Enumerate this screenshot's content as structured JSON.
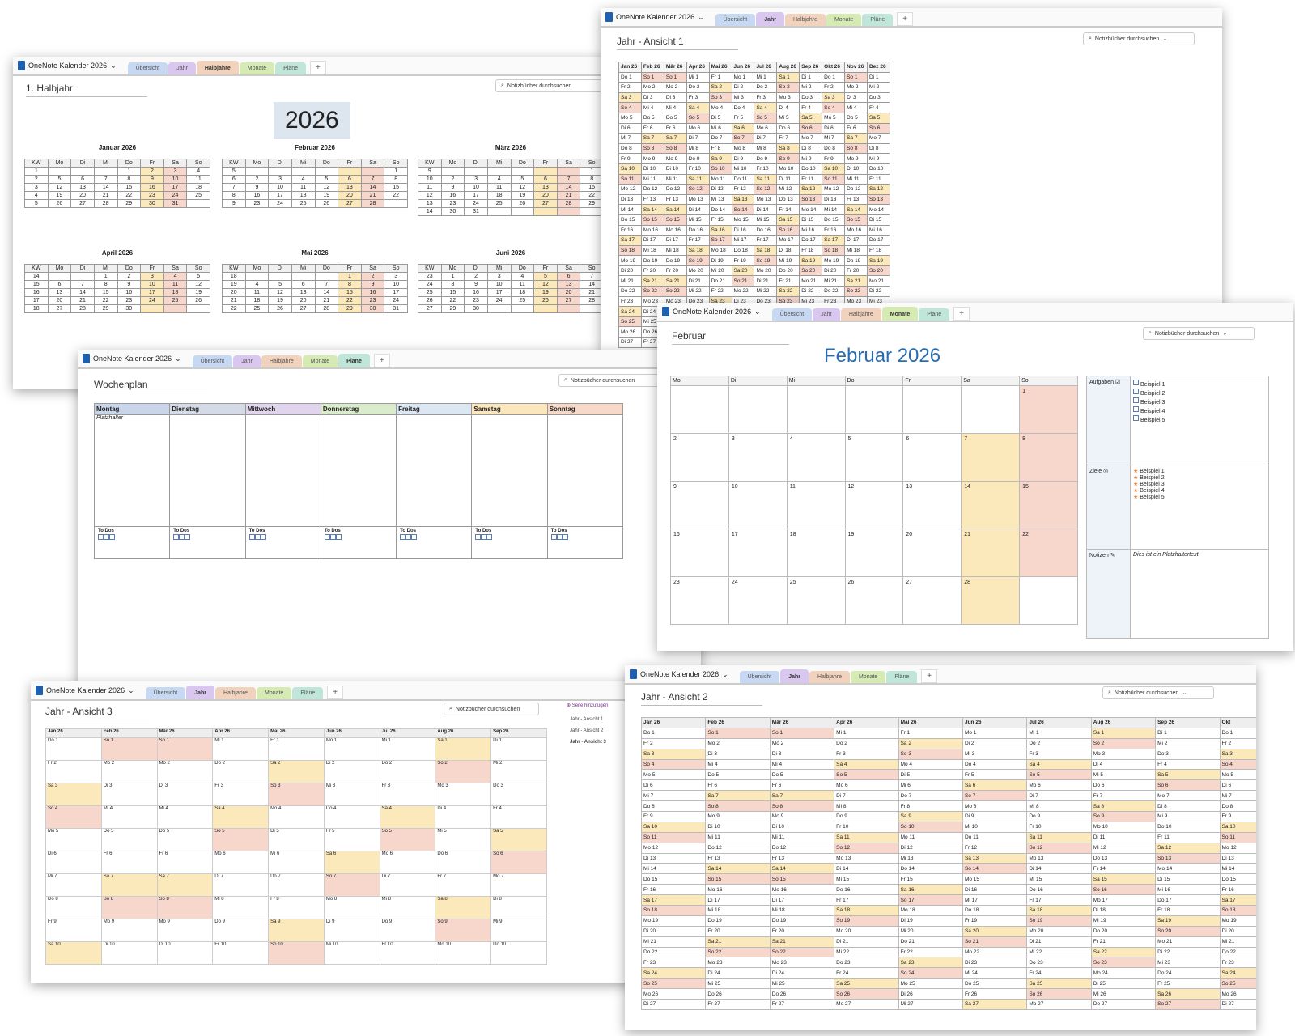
{
  "app": {
    "notebook": "OneNote Kalender 2026",
    "search_placeholder": "Notizbücher durchsuchen",
    "tabs": [
      "Übersicht",
      "Jahr",
      "Halbjahre",
      "Monate",
      "Pläne"
    ],
    "add_tab": "+"
  },
  "colors": {
    "tab_uebersicht": "#c7d9f2",
    "tab_jahr": "#d9c7f0",
    "tab_halbjahre": "#f1d3bd",
    "tab_monate": "#d6ebb4",
    "tab_plaene": "#bfe6d8",
    "saturday": "#fbe9bb",
    "sunday": "#f7d6cc",
    "month_title": "#2a6cb0"
  },
  "halbjahr": {
    "title": "1. Halbjahr",
    "year": "2026",
    "weekday_headers": [
      "KW",
      "Mo",
      "Di",
      "Mi",
      "Do",
      "Fr",
      "Sa",
      "So"
    ],
    "months": [
      {
        "name": "Januar 2026",
        "rows": [
          [
            "1",
            "",
            "",
            "",
            "1",
            "2",
            "3",
            "4"
          ],
          [
            "2",
            "5",
            "6",
            "7",
            "8",
            "9",
            "10",
            "11"
          ],
          [
            "3",
            "12",
            "13",
            "14",
            "15",
            "16",
            "17",
            "18"
          ],
          [
            "4",
            "19",
            "20",
            "21",
            "22",
            "23",
            "24",
            "25"
          ],
          [
            "5",
            "26",
            "27",
            "28",
            "29",
            "30",
            "31",
            ""
          ]
        ]
      },
      {
        "name": "Februar 2026",
        "rows": [
          [
            "5",
            "",
            "",
            "",
            "",
            "",
            "",
            "1"
          ],
          [
            "6",
            "2",
            "3",
            "4",
            "5",
            "6",
            "7",
            "8"
          ],
          [
            "7",
            "9",
            "10",
            "11",
            "12",
            "13",
            "14",
            "15"
          ],
          [
            "8",
            "16",
            "17",
            "18",
            "19",
            "20",
            "21",
            "22"
          ],
          [
            "9",
            "23",
            "24",
            "25",
            "26",
            "27",
            "28",
            ""
          ]
        ]
      },
      {
        "name": "März 2026",
        "rows": [
          [
            "9",
            "",
            "",
            "",
            "",
            "",
            "",
            "1"
          ],
          [
            "10",
            "2",
            "3",
            "4",
            "5",
            "6",
            "7",
            "8"
          ],
          [
            "11",
            "9",
            "10",
            "11",
            "12",
            "13",
            "14",
            "15"
          ],
          [
            "12",
            "16",
            "17",
            "18",
            "19",
            "20",
            "21",
            "22"
          ],
          [
            "13",
            "23",
            "24",
            "25",
            "26",
            "27",
            "28",
            "29"
          ],
          [
            "14",
            "30",
            "31",
            "",
            "",
            "",
            "",
            ""
          ]
        ]
      },
      {
        "name": "April 2026",
        "rows": [
          [
            "14",
            "",
            "",
            "1",
            "2",
            "3",
            "4",
            "5"
          ],
          [
            "15",
            "6",
            "7",
            "8",
            "9",
            "10",
            "11",
            "12"
          ],
          [
            "16",
            "13",
            "14",
            "15",
            "16",
            "17",
            "18",
            "19"
          ],
          [
            "17",
            "20",
            "21",
            "22",
            "23",
            "24",
            "25",
            "26"
          ],
          [
            "18",
            "27",
            "28",
            "29",
            "30",
            "",
            "",
            ""
          ]
        ]
      },
      {
        "name": "Mai 2026",
        "rows": [
          [
            "18",
            "",
            "",
            "",
            "",
            "1",
            "2",
            "3"
          ],
          [
            "19",
            "4",
            "5",
            "6",
            "7",
            "8",
            "9",
            "10"
          ],
          [
            "20",
            "11",
            "12",
            "13",
            "14",
            "15",
            "16",
            "17"
          ],
          [
            "21",
            "18",
            "19",
            "20",
            "21",
            "22",
            "23",
            "24"
          ],
          [
            "22",
            "25",
            "26",
            "27",
            "28",
            "29",
            "30",
            "31"
          ]
        ]
      },
      {
        "name": "Juni 2026",
        "rows": [
          [
            "23",
            "1",
            "2",
            "3",
            "4",
            "5",
            "6",
            "7"
          ],
          [
            "24",
            "8",
            "9",
            "10",
            "11",
            "12",
            "13",
            "14"
          ],
          [
            "25",
            "15",
            "16",
            "17",
            "18",
            "19",
            "20",
            "21"
          ],
          [
            "26",
            "22",
            "23",
            "24",
            "25",
            "26",
            "27",
            "28"
          ],
          [
            "27",
            "29",
            "30",
            "",
            "",
            "",
            "",
            ""
          ]
        ]
      }
    ]
  },
  "jahr1": {
    "title": "Jahr - Ansicht 1",
    "months": [
      "Jan 26",
      "Feb 26",
      "Mär 26",
      "Apr 26",
      "Mai 26",
      "Jun 26",
      "Jul 26",
      "Aug 26",
      "Sep 26",
      "Okt 26",
      "Nov 26",
      "Dez 26"
    ]
  },
  "wochenplan": {
    "title": "Wochenplan",
    "days": [
      "Montag",
      "Dienstag",
      "Mittwoch",
      "Donnerstag",
      "Freitag",
      "Samstag",
      "Sonntag"
    ],
    "day_colors": [
      "#c9d6ea",
      "#d4dae6",
      "#e0d5ec",
      "#dbeccc",
      "#dde7f4",
      "#fbe7bd",
      "#f7d9c9"
    ],
    "placeholder": "Platzhalter",
    "todos": "To Dos"
  },
  "monat": {
    "title": "Februar",
    "heading": "Februar 2026",
    "weekdays": [
      "Mo",
      "Di",
      "Mi",
      "Do",
      "Fr",
      "Sa",
      "So"
    ],
    "weeks": [
      [
        "",
        "",
        "",
        "",
        "",
        "",
        "1"
      ],
      [
        "2",
        "3",
        "4",
        "5",
        "6",
        "7",
        "8"
      ],
      [
        "9",
        "10",
        "11",
        "12",
        "13",
        "14",
        "15"
      ],
      [
        "16",
        "17",
        "18",
        "19",
        "20",
        "21",
        "22"
      ],
      [
        "23",
        "24",
        "25",
        "26",
        "27",
        "28",
        ""
      ]
    ],
    "aufgaben_label": "Aufgaben",
    "ziele_label": "Ziele",
    "notizen_label": "Notizen",
    "examples": [
      "Beispiel 1",
      "Beispiel 2",
      "Beispiel 3",
      "Beispiel 4",
      "Beispiel 5"
    ],
    "notes_text": "Dies ist ein Platzhaltertext"
  },
  "jahr3": {
    "title": "Jahr - Ansicht 3",
    "months": [
      "Jan 26",
      "Feb 26",
      "Mär 26",
      "Apr 26",
      "Mai 26",
      "Jun 26",
      "Jul 26",
      "Aug 26",
      "Sep 26"
    ],
    "add_page": "Seite hinzufügen",
    "pages": [
      "Jahr - Ansicht 1",
      "Jahr - Ansicht 2",
      "Jahr - Ansicht 3"
    ]
  },
  "jahr2": {
    "title": "Jahr - Ansicht 2",
    "months": [
      "Jan 26",
      "Feb 26",
      "Mär 26",
      "Apr 26",
      "Mai 26",
      "Jun 26",
      "Jul 26",
      "Aug 26",
      "Sep 26",
      "Okt"
    ]
  }
}
